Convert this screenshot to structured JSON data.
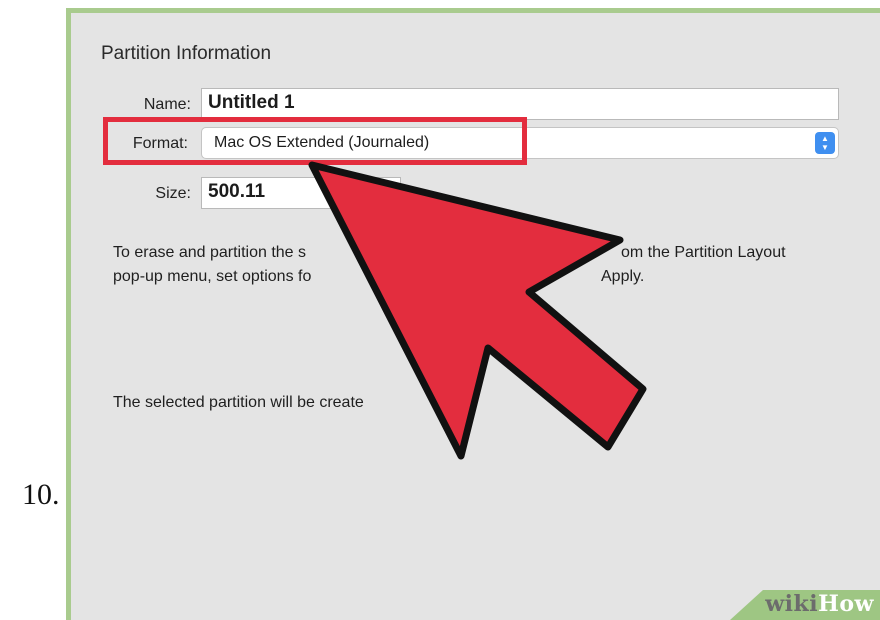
{
  "step": {
    "number": "10."
  },
  "panel": {
    "title": "Partition Information",
    "name_label": "Name:",
    "name_value": "Untitled 1",
    "format_label": "Format:",
    "format_value": "Mac OS Extended (Journaled)",
    "format_stepper_icon": "up-down-arrows-icon",
    "size_label": "Size:",
    "size_value": "500.11",
    "instructions_line1_a": "To erase and partition the s",
    "instructions_line1_b": "om the Partition Layout",
    "instructions_line2_a": "pop-up menu, set options fo",
    "instructions_line2_b": "Apply.",
    "status_text": "The selected partition will be create"
  },
  "annotation": {
    "highlight_color": "#e32d3e",
    "arrow_color": "#e32d3e",
    "arrow_icon": "arrow-pointer-icon"
  },
  "watermark": {
    "part1": "wiki",
    "part2": "How"
  },
  "colors": {
    "frame_green": "#a9cb8e",
    "panel_gray": "#e4e4e4",
    "stepper_blue": "#3f8ff0"
  }
}
